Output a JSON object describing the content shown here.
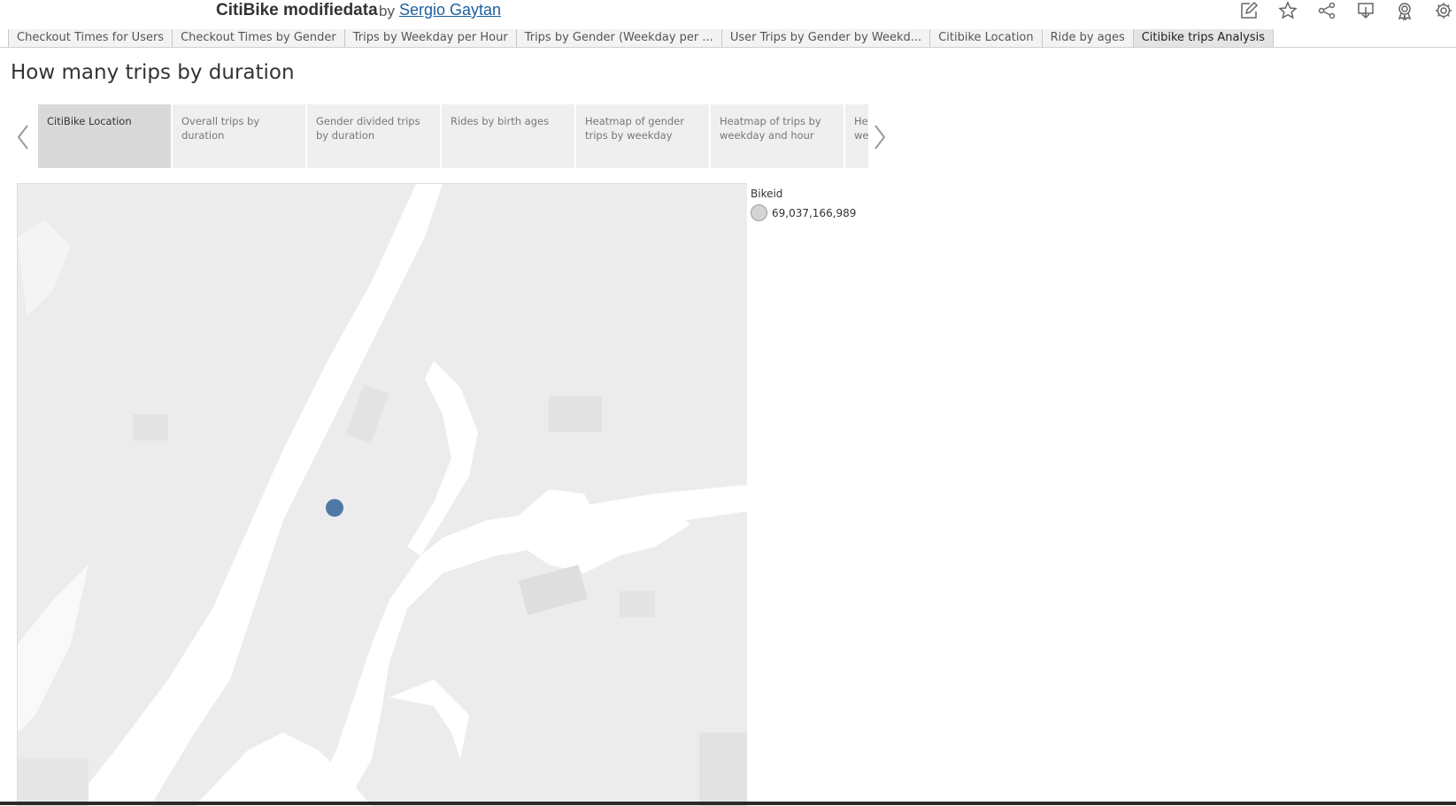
{
  "header": {
    "title": "CitiBike modifiedata",
    "by": "by",
    "author": "Sergio Gaytan",
    "toolbar": [
      "edit-icon",
      "star-icon",
      "share-icon",
      "download-icon",
      "badge-icon",
      "gear-icon"
    ]
  },
  "tabs": [
    {
      "label": "Checkout Times for Users"
    },
    {
      "label": "Checkout Times by Gender"
    },
    {
      "label": "Trips by Weekday per Hour"
    },
    {
      "label": "Trips by Gender (Weekday per ..."
    },
    {
      "label": "User Trips by Gender by Weekd..."
    },
    {
      "label": "Citibike Location"
    },
    {
      "label": "Ride by ages"
    },
    {
      "label": "Citibike trips Analysis",
      "active": true
    }
  ],
  "dashboard": {
    "title": "How many trips by duration"
  },
  "story_points": [
    {
      "label": "CitiBike Location",
      "active": true
    },
    {
      "label": "Overall trips by duration"
    },
    {
      "label": "Gender divided trips by duration"
    },
    {
      "label": "Rides by birth ages"
    },
    {
      "label": "Heatmap of gender trips by weekday"
    },
    {
      "label": "Heatmap of trips by weekday and hour"
    },
    {
      "label": "Heatmap of trips by weekday and gender"
    }
  ],
  "legend": {
    "title": "Bikeid",
    "value": "69,037,166,989"
  },
  "colors": {
    "marker": "#4e79a7",
    "land": "#ececec",
    "water": "#ffffff"
  }
}
